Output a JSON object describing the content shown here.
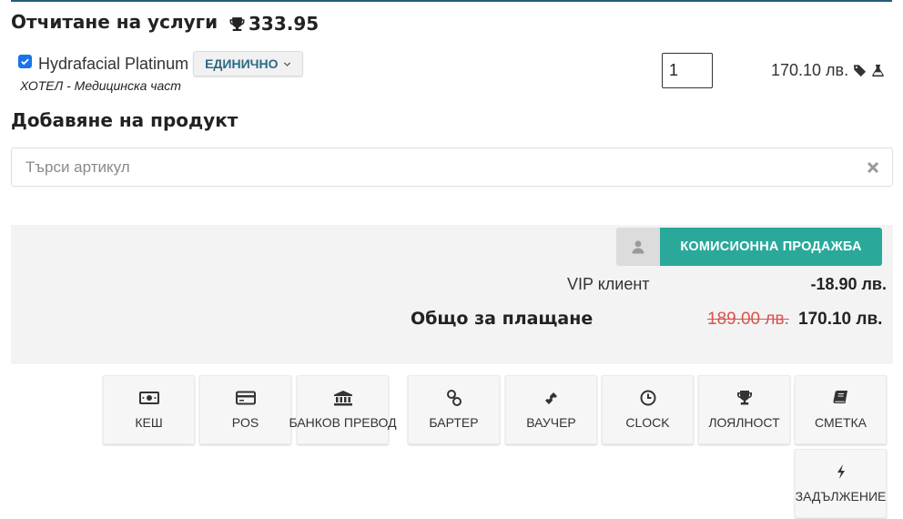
{
  "services": {
    "title": "Отчитане на услуги",
    "points_total": "333.95",
    "item": {
      "checked": true,
      "name": "Hydrafacial Platinum",
      "unit_label": "ЕДИНИЧНО",
      "subtitle": "ХОТЕЛ - Медицинска част",
      "quantity": "1",
      "price": "170.10 лв."
    }
  },
  "product": {
    "title": "Добавяне на продукт",
    "search_placeholder": "Търси артикул"
  },
  "summary": {
    "commission_label": "КОМИСИОННА ПРОДАЖБА",
    "discount_label": "VIP клиент",
    "discount_value": "-18.90 лв.",
    "total_label": "Общо за плащане",
    "total_old": "189.00 лв.",
    "total_new": "170.10 лв."
  },
  "payment_methods": [
    {
      "label": "КЕШ",
      "icon": "money-icon"
    },
    {
      "label": "POS",
      "icon": "credit-card-icon"
    },
    {
      "label": "БАНКОВ ПРЕВОД",
      "icon": "bank-icon"
    },
    {
      "label": "БАРТЕР",
      "icon": "link-icon"
    },
    {
      "label": "ВАУЧЕР",
      "icon": "ticket-icon"
    },
    {
      "label": "CLOCK",
      "icon": "clock-icon"
    },
    {
      "label": "ЛОЯЛНОСТ",
      "icon": "trophy-icon"
    },
    {
      "label": "СМЕТКА",
      "icon": "book-icon"
    },
    {
      "label": "ЗАДЪЛЖЕНИЕ",
      "icon": "bolt-icon"
    }
  ],
  "colors": {
    "accent": "#2aa99a",
    "strike": "#d9534f",
    "link": "#2b6a86",
    "checkbox": "#1a73e8"
  }
}
